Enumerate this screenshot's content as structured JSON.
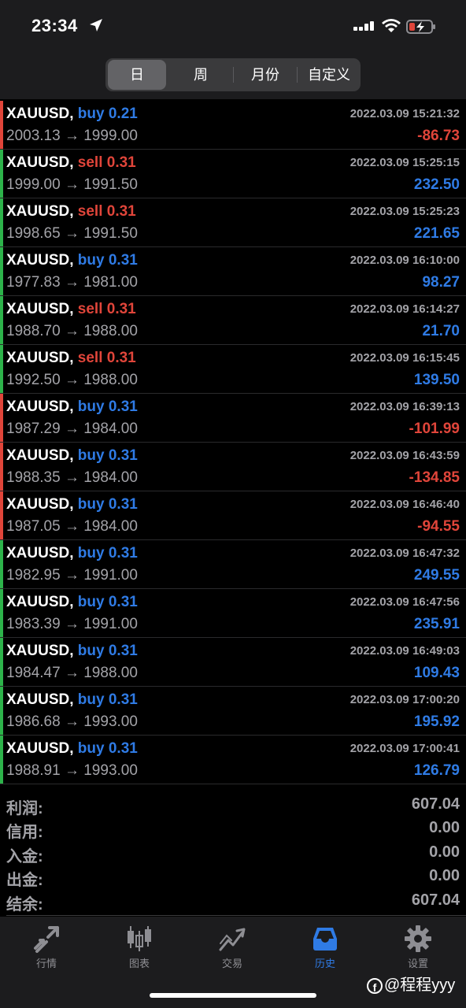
{
  "status_bar": {
    "time": "23:34"
  },
  "segments": [
    {
      "label": "日",
      "active": true
    },
    {
      "label": "周",
      "active": false
    },
    {
      "label": "月份",
      "active": false
    },
    {
      "label": "自定义",
      "active": false
    }
  ],
  "trades": [
    {
      "symbol": "XAUUSD,",
      "side": "buy",
      "volume": "buy 0.21",
      "datetime": "2022.03.09 15:21:32",
      "prices": "2003.13 → 1999.00",
      "profit": "-86.73"
    },
    {
      "symbol": "XAUUSD,",
      "side": "sell",
      "volume": "sell 0.31",
      "datetime": "2022.03.09 15:25:15",
      "prices": "1999.00 → 1991.50",
      "profit": "232.50"
    },
    {
      "symbol": "XAUUSD,",
      "side": "sell",
      "volume": "sell 0.31",
      "datetime": "2022.03.09 15:25:23",
      "prices": "1998.65 → 1991.50",
      "profit": "221.65"
    },
    {
      "symbol": "XAUUSD,",
      "side": "buy",
      "volume": "buy 0.31",
      "datetime": "2022.03.09 16:10:00",
      "prices": "1977.83 → 1981.00",
      "profit": "98.27"
    },
    {
      "symbol": "XAUUSD,",
      "side": "sell",
      "volume": "sell 0.31",
      "datetime": "2022.03.09 16:14:27",
      "prices": "1988.70 → 1988.00",
      "profit": "21.70"
    },
    {
      "symbol": "XAUUSD,",
      "side": "sell",
      "volume": "sell 0.31",
      "datetime": "2022.03.09 16:15:45",
      "prices": "1992.50 → 1988.00",
      "profit": "139.50"
    },
    {
      "symbol": "XAUUSD,",
      "side": "buy",
      "volume": "buy 0.31",
      "datetime": "2022.03.09 16:39:13",
      "prices": "1987.29 → 1984.00",
      "profit": "-101.99"
    },
    {
      "symbol": "XAUUSD,",
      "side": "buy",
      "volume": "buy 0.31",
      "datetime": "2022.03.09 16:43:59",
      "prices": "1988.35 → 1984.00",
      "profit": "-134.85"
    },
    {
      "symbol": "XAUUSD,",
      "side": "buy",
      "volume": "buy 0.31",
      "datetime": "2022.03.09 16:46:40",
      "prices": "1987.05 → 1984.00",
      "profit": "-94.55"
    },
    {
      "symbol": "XAUUSD,",
      "side": "buy",
      "volume": "buy 0.31",
      "datetime": "2022.03.09 16:47:32",
      "prices": "1982.95 → 1991.00",
      "profit": "249.55"
    },
    {
      "symbol": "XAUUSD,",
      "side": "buy",
      "volume": "buy 0.31",
      "datetime": "2022.03.09 16:47:56",
      "prices": "1983.39 → 1991.00",
      "profit": "235.91"
    },
    {
      "symbol": "XAUUSD,",
      "side": "buy",
      "volume": "buy 0.31",
      "datetime": "2022.03.09 16:49:03",
      "prices": "1984.47 → 1988.00",
      "profit": "109.43"
    },
    {
      "symbol": "XAUUSD,",
      "side": "buy",
      "volume": "buy 0.31",
      "datetime": "2022.03.09 17:00:20",
      "prices": "1986.68 → 1993.00",
      "profit": "195.92"
    },
    {
      "symbol": "XAUUSD,",
      "side": "buy",
      "volume": "buy 0.31",
      "datetime": "2022.03.09 17:00:41",
      "prices": "1988.91 → 1993.00",
      "profit": "126.79"
    }
  ],
  "summary": [
    {
      "label": "利润:",
      "value": "607.04"
    },
    {
      "label": "信用:",
      "value": "0.00"
    },
    {
      "label": "入金:",
      "value": "0.00"
    },
    {
      "label": "出金:",
      "value": "0.00"
    },
    {
      "label": "结余:",
      "value": "607.04"
    }
  ],
  "tabs": [
    {
      "label": "行情",
      "icon": "quotes-arrows-icon",
      "active": false
    },
    {
      "label": "图表",
      "icon": "candlestick-chart-icon",
      "active": false
    },
    {
      "label": "交易",
      "icon": "trade-trend-icon",
      "active": false
    },
    {
      "label": "历史",
      "icon": "history-inbox-icon",
      "active": true
    },
    {
      "label": "设置",
      "icon": "gear-icon",
      "active": false
    }
  ],
  "watermark": "@程程yyy",
  "colors": {
    "accent_blue": "#2f7be5",
    "loss_red": "#e0453a",
    "win_bar_green": "#2db34a",
    "loss_bar_red": "#e0453a"
  }
}
